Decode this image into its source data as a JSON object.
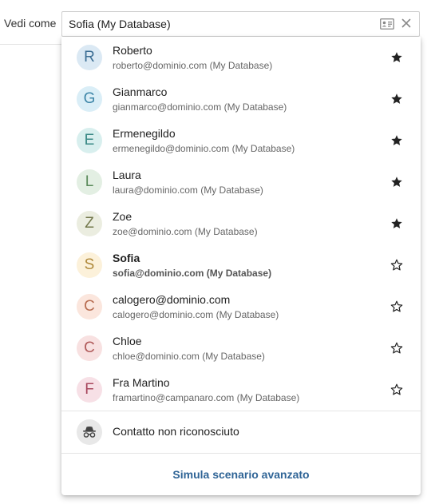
{
  "header": {
    "label": "Vedi come",
    "selected_value": "Sofia (My Database)",
    "contact_icon": "contact-card-icon",
    "clear_icon": "close-icon"
  },
  "contacts": [
    {
      "initial": "R",
      "name": "Roberto",
      "email": "roberto@dominio.com (My Database)",
      "starred": true,
      "bg": "#dbe9f4",
      "fg": "#3d6f95"
    },
    {
      "initial": "G",
      "name": "Gianmarco",
      "email": "gianmarco@dominio.com (My Database)",
      "starred": true,
      "bg": "#daeef7",
      "fg": "#3e86a8"
    },
    {
      "initial": "E",
      "name": "Ermenegildo",
      "email": "ermenegildo@dominio.com (My Database)",
      "starred": true,
      "bg": "#d8efee",
      "fg": "#3a8a86"
    },
    {
      "initial": "L",
      "name": "Laura",
      "email": "laura@dominio.com (My Database)",
      "starred": true,
      "bg": "#e3efe3",
      "fg": "#5a8a5a"
    },
    {
      "initial": "Z",
      "name": "Zoe",
      "email": "zoe@dominio.com (My Database)",
      "starred": true,
      "bg": "#ebede0",
      "fg": "#72774a"
    },
    {
      "initial": "S",
      "name": "Sofia",
      "email": "sofia@dominio.com (My Database)",
      "starred": false,
      "selected": true,
      "bg": "#fcf1da",
      "fg": "#b08a3c"
    },
    {
      "initial": "C",
      "name": "calogero@dominio.com",
      "email": "calogero@dominio.com (My Database)",
      "starred": false,
      "bg": "#fbe6dd",
      "fg": "#b86e52"
    },
    {
      "initial": "C",
      "name": "Chloe",
      "email": "chloe@dominio.com (My Database)",
      "starred": false,
      "bg": "#f8e1e1",
      "fg": "#b05a5a"
    },
    {
      "initial": "F",
      "name": "Fra Martino",
      "email": "framartino@campanaro.com (My Database)",
      "starred": false,
      "bg": "#f7e0e6",
      "fg": "#a8485e"
    }
  ],
  "unknown_contact": {
    "label": "Contatto non riconosciuto",
    "icon": "incognito-icon"
  },
  "advanced_link": "Simula scenario avanzato",
  "colors": {
    "accent": "#2f6496",
    "star": "#222222"
  }
}
